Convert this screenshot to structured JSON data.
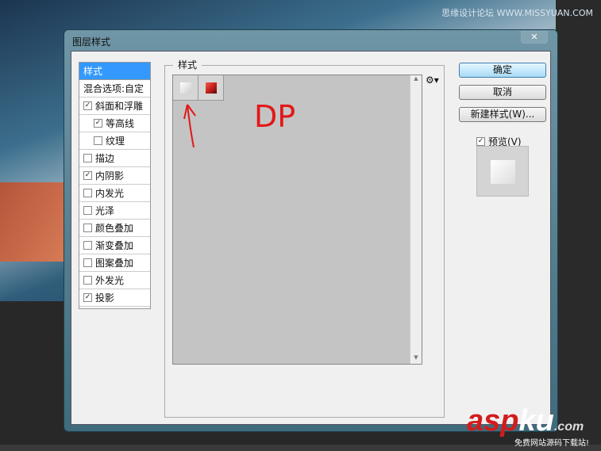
{
  "window": {
    "title": "图层样式",
    "close": "✕"
  },
  "watermark": {
    "top": "思缘设计论坛 WWW.MISSYUAN.COM",
    "logo_red": "asp",
    "logo_white": "ku",
    ".com": ".com",
    "logo_tld": ".com",
    "logo_sub": "免费网站源码下载站!"
  },
  "styles_list": [
    {
      "label": "样式",
      "selected": true
    },
    {
      "label": "混合选项:自定"
    },
    {
      "label": "斜面和浮雕",
      "checked": true
    },
    {
      "label": "等高线",
      "checked": true,
      "indent": true
    },
    {
      "label": "纹理",
      "checked": false,
      "indent": true
    },
    {
      "label": "描边",
      "checked": false
    },
    {
      "label": "内阴影",
      "checked": true
    },
    {
      "label": "内发光",
      "checked": false
    },
    {
      "label": "光泽",
      "checked": false
    },
    {
      "label": "颜色叠加",
      "checked": false
    },
    {
      "label": "渐变叠加",
      "checked": false
    },
    {
      "label": "图案叠加",
      "checked": false
    },
    {
      "label": "外发光",
      "checked": false
    },
    {
      "label": "投影",
      "checked": true
    }
  ],
  "panel": {
    "group_label": "样式",
    "annotation": "DP"
  },
  "buttons": {
    "ok": "确定",
    "cancel": "取消",
    "new_style": "新建样式(W)..."
  },
  "preview": {
    "label": "预览(V)",
    "checked": true
  },
  "colors": {
    "selected": "#3399ff",
    "swatch_red": "#c8201c"
  }
}
